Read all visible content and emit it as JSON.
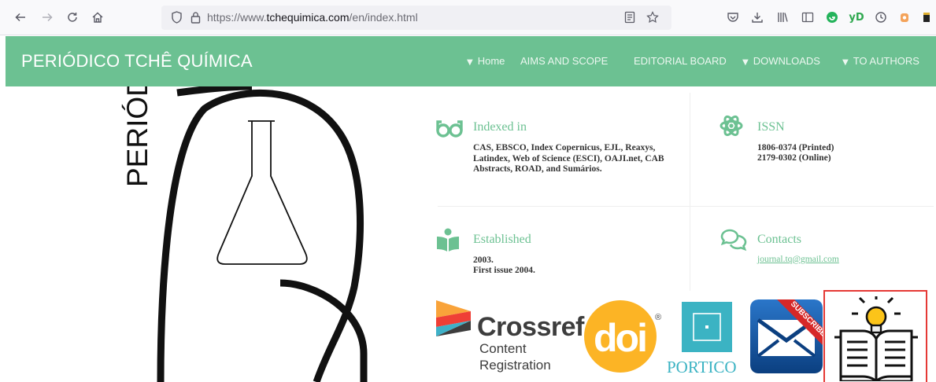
{
  "browser": {
    "url_prefix": "https://www.",
    "url_domain": "tchequimica.com",
    "url_path": "/en/index.html",
    "icons": {
      "back": "back-arrow-icon",
      "forward": "forward-arrow-icon",
      "reload": "reload-icon",
      "home": "home-icon",
      "shield": "shield-icon",
      "lock": "lock-icon",
      "reader": "reader-view-icon",
      "bookmark": "bookmark-star-icon"
    },
    "extensions": [
      "pocket-icon",
      "download-icon",
      "library-icon",
      "sidebar-icon",
      "green-extension-icon",
      "yd-extension-icon",
      "sync-icon",
      "account-icon"
    ],
    "yd_label": "yD"
  },
  "header": {
    "title": "PERIÓDICO TCHÊ QUÍMICA",
    "nav": [
      {
        "label": "Home",
        "has_chevron": true
      },
      {
        "label": "AIMS AND SCOPE",
        "has_chevron": false
      },
      {
        "label": "EDITORIAL BOARD",
        "has_chevron": false
      },
      {
        "label": "DOWNLOADS",
        "has_chevron": true
      },
      {
        "label": "TO AUTHORS",
        "has_chevron": true
      }
    ],
    "color": "#6cc192"
  },
  "logo": {
    "vertical_text": "PERIÓD"
  },
  "info": {
    "indexed": {
      "title": "Indexed in",
      "body": "CAS, EBSCO, Index Copernicus, EJL, Reaxys, Latindex, Web of Science (ESCI), OAJI.net, CAB Abstracts, ROAD, and Sumários."
    },
    "issn": {
      "title": "ISSN",
      "line1": "1806-0374 (Printed)",
      "line2": "2179-0302 (Online)"
    },
    "established": {
      "title": "Established",
      "line1": "2003.",
      "line2": "First issue 2004."
    },
    "contacts": {
      "title": "Contacts",
      "email": "journal.tq@gmail.com"
    }
  },
  "partners": {
    "crossref_title": "Crossref",
    "crossref_line1": "Content",
    "crossref_line2": "Registration",
    "doi_label": "doi",
    "registered_mark": "®",
    "portico_label": "PORTICO",
    "subscribe_label": "SUBSCRIBE"
  }
}
